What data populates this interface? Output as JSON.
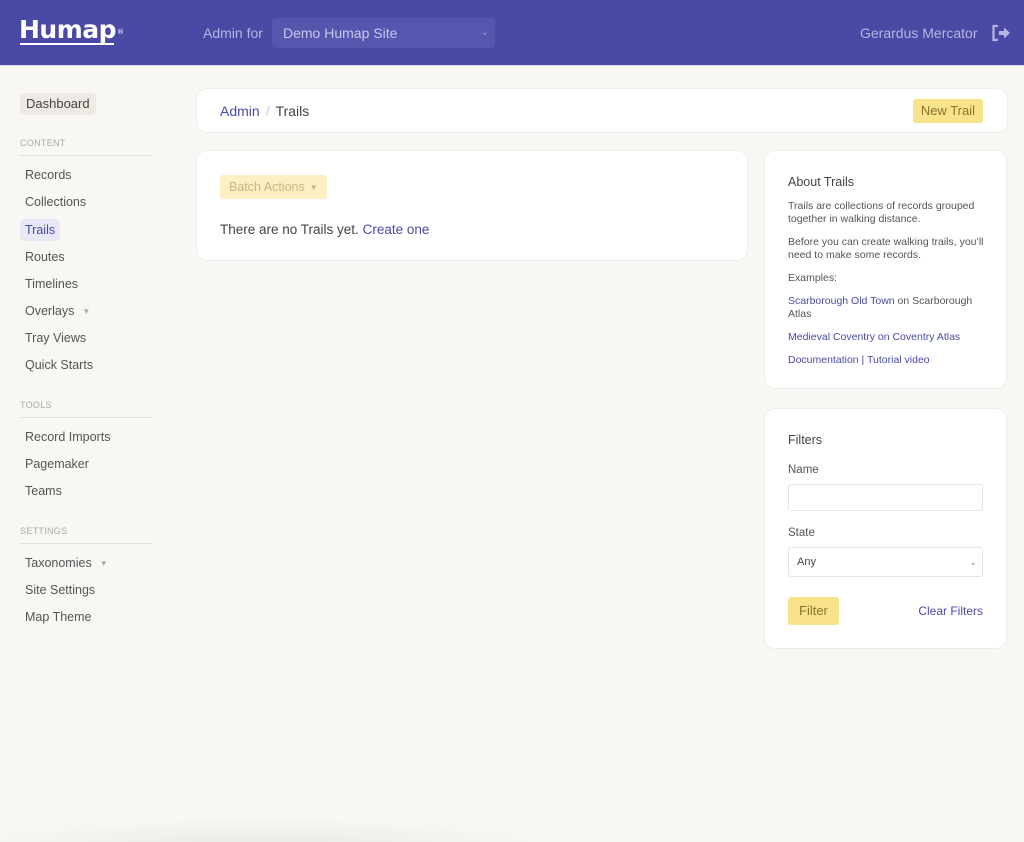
{
  "header": {
    "logo": "Humap",
    "logo_mark": "®",
    "admin_for_label": "Admin for",
    "site_select_value": "Demo Humap Site",
    "user_name": "Gerardus Mercator",
    "logout_icon": "sign-out-icon"
  },
  "sidebar": {
    "dashboard": "Dashboard",
    "sections": [
      {
        "label": "CONTENT",
        "items": [
          {
            "label": "Records"
          },
          {
            "label": "Collections"
          },
          {
            "label": "Trails",
            "active": true
          },
          {
            "label": "Routes"
          },
          {
            "label": "Timelines"
          },
          {
            "label": "Overlays",
            "has_submenu": true
          },
          {
            "label": "Tray Views"
          },
          {
            "label": "Quick Starts"
          }
        ]
      },
      {
        "label": "TOOLS",
        "items": [
          {
            "label": "Record Imports"
          },
          {
            "label": "Pagemaker"
          },
          {
            "label": "Teams"
          }
        ]
      },
      {
        "label": "SETTINGS",
        "items": [
          {
            "label": "Taxonomies",
            "has_submenu": true
          },
          {
            "label": "Site Settings"
          },
          {
            "label": "Map Theme"
          }
        ]
      }
    ]
  },
  "breadcrumb": {
    "root": "Admin",
    "separator": "/",
    "current": "Trails",
    "new_button": "New Trail"
  },
  "main": {
    "batch_actions": "Batch Actions",
    "empty_text": "There are no Trails yet.",
    "create_link": "Create one"
  },
  "about": {
    "title": "About Trails",
    "para1": "Trails are collections of records grouped together in walking distance.",
    "para2": "Before you can create walking trails, you’ll need to make some records.",
    "examples_label": "Examples:",
    "example1_link": "Scarborough Old Town",
    "example1_suffix": " on Scarborough Atlas",
    "example2_link": "Medieval Coventry on Coventry Atlas",
    "docs_link": "Documentation",
    "links_sep": " | ",
    "video_link": "Tutorial video"
  },
  "filters": {
    "title": "Filters",
    "name_label": "Name",
    "name_value": "",
    "name_placeholder": "",
    "state_label": "State",
    "state_value": "Any",
    "filter_button": "Filter",
    "clear_link": "Clear Filters"
  },
  "colors": {
    "brand": "#4a4aa6",
    "accent_button": "#f9e38a",
    "background": "#f8f7f4"
  }
}
